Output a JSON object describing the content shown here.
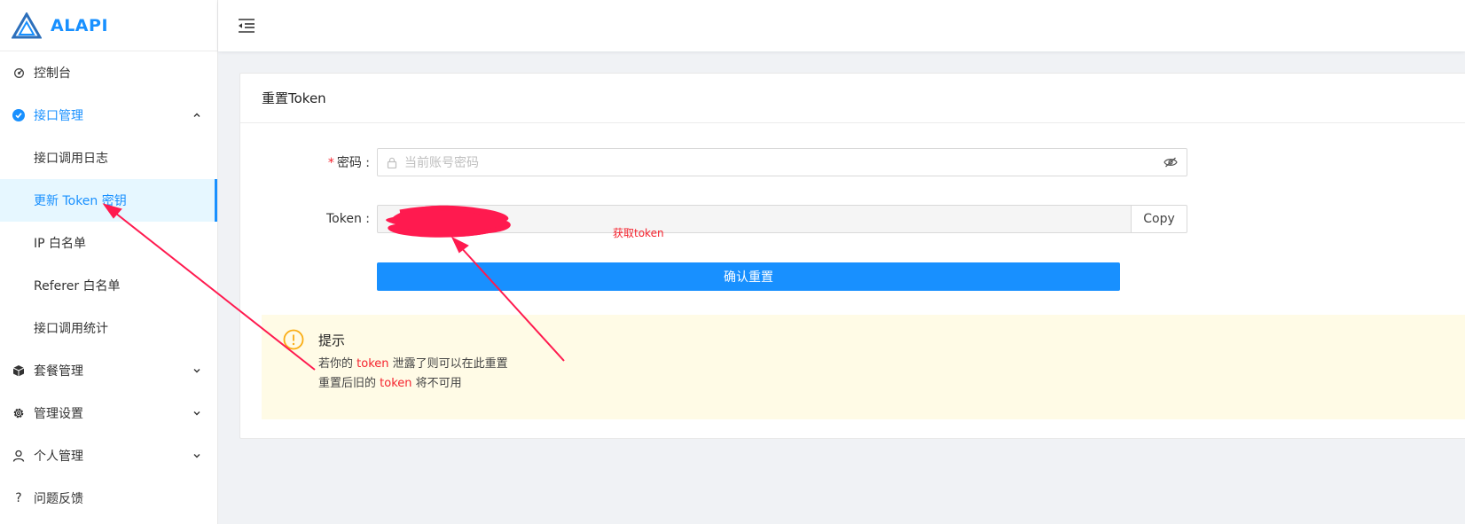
{
  "app": {
    "name": "ALAPI"
  },
  "sidebar": {
    "items": [
      {
        "label": "控制台",
        "icon": "dashboard-icon"
      },
      {
        "label": "接口管理",
        "icon": "check-circle-icon",
        "open": true,
        "children": [
          {
            "label": "接口调用日志"
          },
          {
            "label": "更新 Token 密钥",
            "active": true
          },
          {
            "label": "IP 白名单"
          },
          {
            "label": "Referer 白名单"
          },
          {
            "label": "接口调用统计"
          }
        ]
      },
      {
        "label": "套餐管理",
        "icon": "package-icon"
      },
      {
        "label": "管理设置",
        "icon": "gear-icon"
      },
      {
        "label": "个人管理",
        "icon": "user-icon"
      },
      {
        "label": "问题反馈",
        "icon": "question-icon"
      }
    ]
  },
  "card": {
    "title": "重置Token",
    "password": {
      "required_mark": "*",
      "label": "密码",
      "placeholder": "当前账号密码"
    },
    "token": {
      "label": "Token",
      "copy_label": "Copy"
    },
    "confirm_label": "确认重置",
    "annotation": "获取token"
  },
  "alert": {
    "title": "提示",
    "line1": {
      "a": "若你的 ",
      "hl": "token",
      "b": " 泄露了则可以在此重置"
    },
    "line2": {
      "a": "重置后旧的 ",
      "hl": "token",
      "b": " 将不可用"
    }
  },
  "colors": {
    "primary": "#1890ff",
    "danger": "#f5222d",
    "warning_bg": "#fffbe6",
    "warning_icon": "#faad14",
    "annotation": "#ff1a4f"
  }
}
